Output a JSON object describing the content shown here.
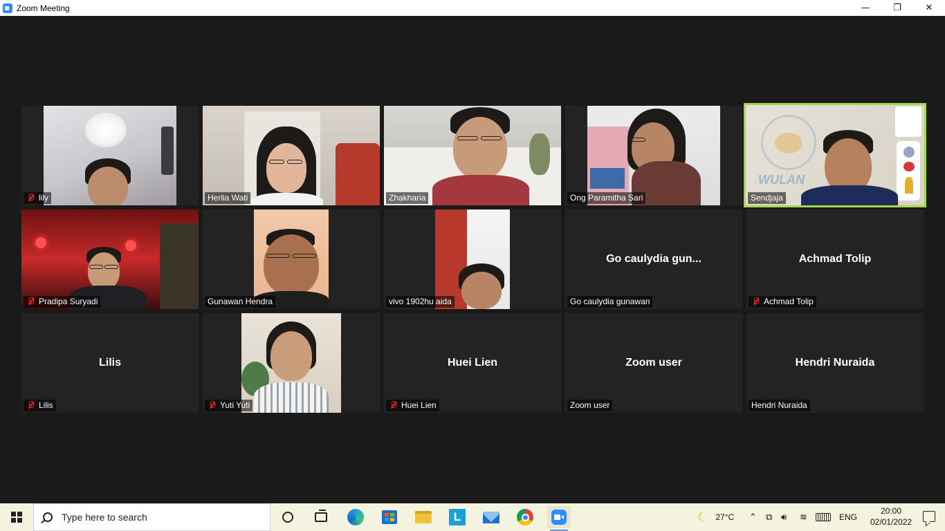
{
  "window": {
    "title": "Zoom Meeting",
    "controls": {
      "minimize": "—",
      "restore": "❐",
      "close": "✕"
    }
  },
  "participants": [
    {
      "name": "lily",
      "muted": true,
      "video": true,
      "active_speaker": false
    },
    {
      "name": "Herlia Wati",
      "muted": false,
      "video": true,
      "active_speaker": false
    },
    {
      "name": "Zhakharia",
      "muted": false,
      "video": true,
      "active_speaker": false
    },
    {
      "name": "Ong Paramitha Sari",
      "muted": false,
      "video": true,
      "active_speaker": false
    },
    {
      "name": "Sendjaja",
      "muted": false,
      "video": true,
      "active_speaker": true,
      "background_text": "WULAN"
    },
    {
      "name": "Pradipa Suryadi",
      "muted": true,
      "video": true,
      "active_speaker": false
    },
    {
      "name": "Gunawan Hendra",
      "muted": false,
      "video": true,
      "active_speaker": false
    },
    {
      "name": "vivo 1902hu aida",
      "muted": false,
      "video": true,
      "active_speaker": false
    },
    {
      "name": "Go caulydia gunawan",
      "display": "Go caulydia gun...",
      "muted": false,
      "video": false,
      "active_speaker": false
    },
    {
      "name": "Achmad Tolip",
      "display": "Achmad Tolip",
      "muted": true,
      "video": false,
      "active_speaker": false
    },
    {
      "name": "Lilis",
      "display": "Lilis",
      "muted": true,
      "video": false,
      "active_speaker": false
    },
    {
      "name": "Yuti Yuti",
      "muted": true,
      "video": true,
      "active_speaker": false
    },
    {
      "name": "Huei Lien",
      "display": "Huei Lien",
      "muted": true,
      "video": false,
      "active_speaker": false
    },
    {
      "name": "Zoom user",
      "display": "Zoom user",
      "muted": false,
      "video": false,
      "active_speaker": false
    },
    {
      "name": "Hendri Nuraida",
      "display": "Hendri Nuraida",
      "muted": false,
      "video": false,
      "active_speaker": false
    }
  ],
  "taskbar": {
    "search_placeholder": "Type here to search",
    "pinned_apps": [
      "cortana-icon",
      "task-view-icon",
      "edge-icon",
      "store-icon",
      "file-explorer-icon",
      "l-app-icon",
      "mail-icon",
      "chrome-icon",
      "zoom-icon"
    ],
    "weather": "27°C",
    "language": "ENG",
    "time": "20:00",
    "date": "02/01/2022"
  },
  "colors": {
    "active_speaker_border": "#a6d64a",
    "mute_icon": "#e02828",
    "stage_bg": "#1a1a1a",
    "tile_bg": "#232323",
    "taskbar_bg": "#f3f3df"
  }
}
